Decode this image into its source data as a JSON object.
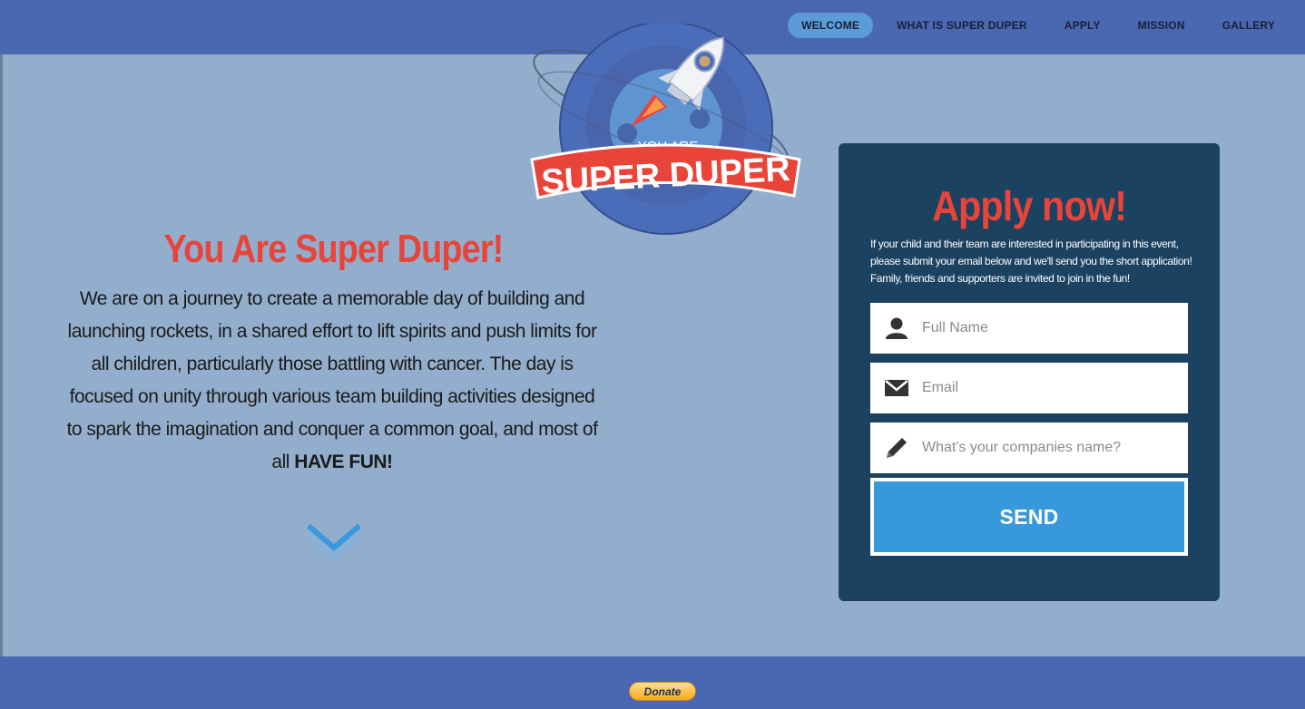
{
  "nav": {
    "items": [
      {
        "label": "WELCOME",
        "active": true
      },
      {
        "label": "WHAT IS SUPER DUPER",
        "active": false
      },
      {
        "label": "APPLY",
        "active": false
      },
      {
        "label": "MISSION",
        "active": false
      },
      {
        "label": "GALLERY",
        "active": false
      }
    ]
  },
  "logo": {
    "line1": "YOU ARE",
    "line2": "SUPER DUPER"
  },
  "hero": {
    "title": "You Are Super Duper!",
    "body": "We are on a journey to create a memorable day of building and launching rockets, in a shared effort to lift spirits and push limits for all children, particularly those battling with cancer. The day is focused on unity through various team building activities designed to spark the imagination and conquer a common goal, and most of all ",
    "emphasis": "HAVE FUN!",
    "scroll_icon": "chevron-down-icon"
  },
  "apply": {
    "title": "Apply now!",
    "description": "If your child and their team are interested in participating in this event, please submit your email below and we'll send you the short application! Family, friends and supporters are invited to join in the fun!",
    "fields": [
      {
        "placeholder": "Full Name",
        "value": "",
        "icon": "user-icon"
      },
      {
        "placeholder": "Email",
        "value": "",
        "icon": "envelope-icon"
      },
      {
        "placeholder": "What's your companies name?",
        "value": "",
        "icon": "pencil-icon"
      }
    ],
    "submit_label": "SEND"
  },
  "footer": {
    "donate_label": "Donate"
  },
  "colors": {
    "nav_bg": "#4a67b2",
    "page_bg": "#93aecc",
    "accent_red": "#e8443a",
    "panel_bg": "#1c4262",
    "button_blue": "#3799dc",
    "nav_active": "#5b9bd8"
  }
}
